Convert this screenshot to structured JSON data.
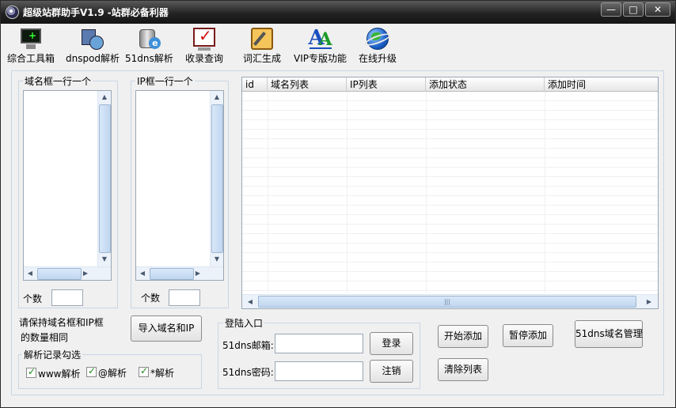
{
  "window": {
    "title": "超级站群助手V1.9 -站群必备利器",
    "minimize": "—",
    "maximize": "□",
    "close": "✕"
  },
  "toolbar": {
    "items": [
      {
        "label": "综合工具箱",
        "icon": "monitor-icon"
      },
      {
        "label": "dnspod解析",
        "icon": "network-icon"
      },
      {
        "label": "51dns解析",
        "icon": "server-icon"
      },
      {
        "label": "收录查询",
        "icon": "checkmark-icon"
      },
      {
        "label": "词汇生成",
        "icon": "notepad-icon"
      },
      {
        "label": "VIP专版功能",
        "icon": "font-icon"
      },
      {
        "label": "在线升级",
        "icon": "globe-icon"
      }
    ]
  },
  "domain_box": {
    "label": "域名框一行一个",
    "count_label": "个数",
    "count_value": ""
  },
  "ip_box": {
    "label": "IP框一行一个",
    "count_label": "个数",
    "count_value": ""
  },
  "table": {
    "columns": [
      "id",
      "域名列表",
      "IP列表",
      "添加状态",
      "添加时间"
    ],
    "rows": []
  },
  "hint": {
    "line1": "请保持域名框和IP框",
    "line2": "的数量相同"
  },
  "import_button": "导入域名和IP",
  "parse_records": {
    "label": "解析记录勾选",
    "options": [
      {
        "label": "www解析",
        "checked": true
      },
      {
        "label": "@解析",
        "checked": true
      },
      {
        "label": "*解析",
        "checked": true
      }
    ]
  },
  "login": {
    "label": "登陆入口",
    "email_label": "51dns邮箱:",
    "email_value": "",
    "password_label": "51dns密码:",
    "password_value": "",
    "login_button": "登录",
    "logout_button": "注销"
  },
  "actions": {
    "start": "开始添加",
    "pause": "暂停添加",
    "manage": "51dns域名管理",
    "clear": "清除列表"
  },
  "scroll": {
    "up": "▲",
    "down": "▼",
    "left": "◀",
    "right": "▶",
    "grip": "|||"
  }
}
